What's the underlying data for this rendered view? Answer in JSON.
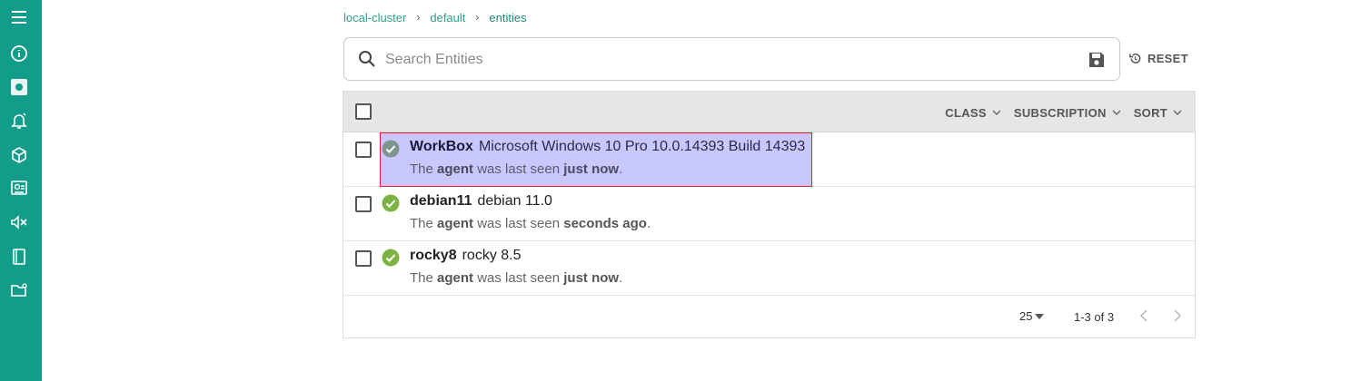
{
  "sidebar": {
    "items": [
      {
        "name": "menu-icon"
      },
      {
        "name": "info-icon"
      },
      {
        "name": "dashboard-icon"
      },
      {
        "name": "bell-icon"
      },
      {
        "name": "box-icon"
      },
      {
        "name": "entities-icon"
      },
      {
        "name": "silence-icon"
      },
      {
        "name": "book-icon"
      },
      {
        "name": "folder-icon"
      }
    ]
  },
  "breadcrumb": {
    "items": [
      "local-cluster",
      "default",
      "entities"
    ],
    "separator": "›"
  },
  "search": {
    "placeholder": "Search Entities",
    "value": ""
  },
  "reset": {
    "label": "RESET"
  },
  "header": {
    "class_label": "CLASS",
    "subscription_label": "SUBSCRIPTION",
    "sort_label": "SORT"
  },
  "entities": [
    {
      "name": "WorkBox",
      "os": "Microsoft Windows 10 Pro 10.0.14393 Build 14393",
      "prefix": "The ",
      "agent": "agent",
      "middle": " was last seen ",
      "seen": "just now",
      "suffix": "."
    },
    {
      "name": "debian11",
      "os": "debian 11.0",
      "prefix": "The ",
      "agent": "agent",
      "middle": " was last seen ",
      "seen": "seconds ago",
      "suffix": "."
    },
    {
      "name": "rocky8",
      "os": "rocky 8.5",
      "prefix": "The ",
      "agent": "agent",
      "middle": " was last seen ",
      "seen": "just now",
      "suffix": "."
    }
  ],
  "pagination": {
    "per_page": "25",
    "range": "1-3 of 3"
  },
  "colors": {
    "sidebar": "#129c8a",
    "status_ok": "#7cb342",
    "highlight_fill": "#c8c8ff",
    "highlight_border": "#e01c2c"
  }
}
